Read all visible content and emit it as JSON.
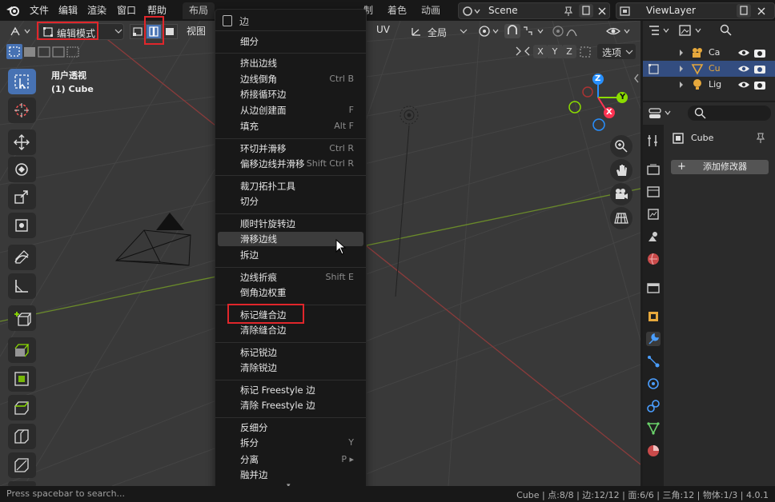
{
  "topbar": {
    "menus": [
      "文件",
      "编辑",
      "渲染",
      "窗口",
      "帮助"
    ],
    "workspace_tabs": [
      "布局",
      "制",
      "着色",
      "动画"
    ],
    "scene": "Scene",
    "view_layer": "ViewLayer"
  },
  "viewport_header": {
    "mode": "编辑模式",
    "view_menu": "视图",
    "uv_menu": "UV",
    "transform_orientation": "全局",
    "xyz": [
      "X",
      "Y",
      "Z"
    ],
    "select_menu": "选项"
  },
  "viewport_info": {
    "view_name": "用户透视",
    "object_name": "(1) Cube"
  },
  "gizmo": {
    "z": "Z",
    "y": "Y",
    "x": "X"
  },
  "edge_menu": {
    "title": "边",
    "groups": [
      [
        {
          "label": "细分",
          "shortcut": ""
        }
      ],
      [
        {
          "label": "挤出边线",
          "shortcut": ""
        },
        {
          "label": "边线倒角",
          "shortcut": "Ctrl B"
        },
        {
          "label": "桥接循环边",
          "shortcut": ""
        },
        {
          "label": "从边创建面",
          "shortcut": "F"
        },
        {
          "label": "填充",
          "shortcut": "Alt F"
        }
      ],
      [
        {
          "label": "环切并滑移",
          "shortcut": "Ctrl R"
        },
        {
          "label": "偏移边线并滑移",
          "shortcut": "Shift Ctrl R"
        }
      ],
      [
        {
          "label": "裁刀拓扑工具",
          "shortcut": ""
        },
        {
          "label": "切分",
          "shortcut": ""
        }
      ],
      [
        {
          "label": "顺时针旋转边",
          "shortcut": ""
        },
        {
          "label": "滑移边线",
          "shortcut": ""
        },
        {
          "label": "拆边",
          "shortcut": ""
        }
      ],
      [
        {
          "label": "边线折痕",
          "shortcut": "Shift E"
        },
        {
          "label": "倒角边权重",
          "shortcut": ""
        }
      ],
      [
        {
          "label": "标记缝合边",
          "shortcut": ""
        },
        {
          "label": "清除缝合边",
          "shortcut": ""
        }
      ],
      [
        {
          "label": "标记锐边",
          "shortcut": ""
        },
        {
          "label": "清除锐边",
          "shortcut": ""
        }
      ],
      [
        {
          "label": "标记 Freestyle 边",
          "shortcut": ""
        },
        {
          "label": "清除 Freestyle 边",
          "shortcut": ""
        }
      ],
      [
        {
          "label": "反细分",
          "shortcut": ""
        },
        {
          "label": "拆分",
          "shortcut": "Y"
        },
        {
          "label": "分离",
          "shortcut": "P ▸"
        },
        {
          "label": "融并边",
          "shortcut": ""
        }
      ]
    ],
    "more_arrow": "▾"
  },
  "outliner": {
    "rows": [
      {
        "name": "Ca",
        "icon": "camera-icon",
        "selected": false
      },
      {
        "name": "Cu",
        "icon": "mesh-icon",
        "selected": true
      },
      {
        "name": "Lig",
        "icon": "light-icon",
        "selected": false
      }
    ]
  },
  "properties": {
    "object_name": "Cube",
    "add_modifier": "添加修改器"
  },
  "statusbar": {
    "hint": "Press spacebar to search...",
    "stats": "Cube | 点:8/8 | 边:12/12 | 面:6/6 | 三角:12 | 物体:1/3 | 4.0.1"
  },
  "colors": {
    "accent": "#4772b3",
    "highlight_box": "#e0262b",
    "axis_x": "#ff3352",
    "axis_y": "#8bdc00",
    "axis_z": "#2890ff"
  }
}
